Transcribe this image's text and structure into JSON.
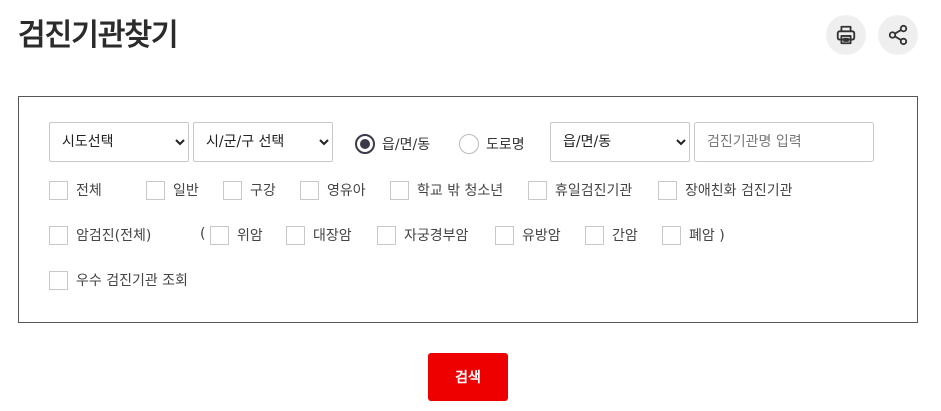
{
  "header": {
    "title": "검진기관찾기",
    "print_icon": "printer-icon",
    "share_icon": "share-icon"
  },
  "filters": {
    "sido_select": {
      "selected": "시도선택"
    },
    "sigungu_select": {
      "selected": "시/군/구 선택"
    },
    "address_type": {
      "options": [
        {
          "label": "읍/면/동",
          "checked": true
        },
        {
          "label": "도로명",
          "checked": false
        }
      ]
    },
    "dong_select": {
      "selected": "읍/면/동"
    },
    "name_input": {
      "placeholder": "검진기관명 입력",
      "value": ""
    },
    "row1": [
      "전체",
      "일반",
      "구강",
      "영유아",
      "학교 밖 청소년",
      "휴일검진기관",
      "장애친화 검진기관"
    ],
    "cancer_all": "암검진(전체)",
    "paren_open": "(",
    "cancer_types": [
      "위암",
      "대장암",
      "자궁경부암",
      "유방암",
      "간암",
      "폐암 )"
    ],
    "excellent": "우수 검진기관 조회"
  },
  "search_button": {
    "label": "검색"
  },
  "colors": {
    "accent": "#ee0000",
    "radio_checked": "#3a3a48"
  }
}
